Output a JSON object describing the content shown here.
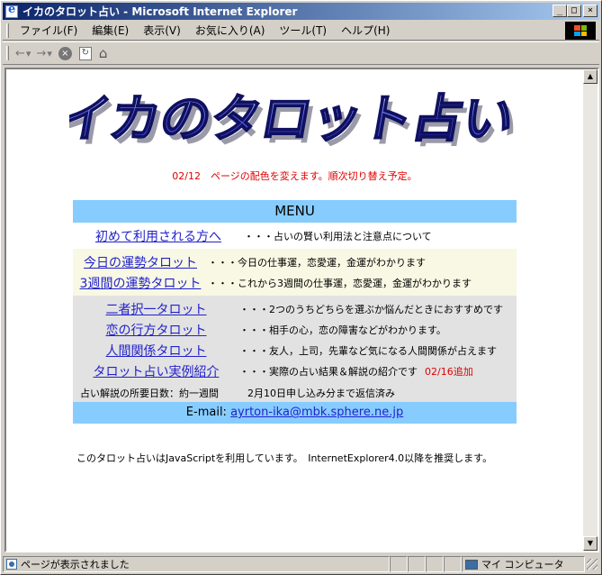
{
  "window": {
    "title": "イカのタロット占い - Microsoft Internet Explorer",
    "controls": {
      "minimize": "_",
      "maximize": "□",
      "close": "×"
    }
  },
  "menubar": [
    "ファイル(F)",
    "編集(E)",
    "表示(V)",
    "お気に入り(A)",
    "ツール(T)",
    "ヘルプ(H)"
  ],
  "toolbar": {
    "back": "←",
    "forward": "→"
  },
  "page": {
    "logo_text": "イカのタロット占い",
    "notice": "02/12　ページの配色を変えます。順次切り替え予定。",
    "menu_heading": "MENU",
    "sections": [
      {
        "style": "white",
        "items": [
          {
            "link": "初めて利用される方へ",
            "desc": "・・・占いの賢い利用法と注意点について",
            "link_w": 190
          }
        ]
      },
      {
        "style": "cream",
        "items": [
          {
            "link": "今日の運勢タロット",
            "desc": "・・・今日の仕事運，恋愛運，金運がわかります",
            "link_w": 150
          },
          {
            "link": "3週間の運勢タロット",
            "desc": "・・・これから3週間の仕事運，恋愛運，金運がわかります",
            "link_w": 150
          }
        ]
      },
      {
        "style": "gray",
        "items": [
          {
            "link": "二者択一タロット",
            "desc": "・・・2つのうちどちらを選ぶか悩んだときにおすすめです",
            "link_w": 185
          },
          {
            "link": "恋の行方タロット",
            "desc": "・・・相手の心，恋の障害などがわかります。",
            "link_w": 185
          },
          {
            "link": "人間関係タロット",
            "desc": "・・・友人，上司，先輩など気になる人間関係が占えます",
            "link_w": 185
          },
          {
            "link": "タロット占い実例紹介",
            "desc": "・・・実際の占い結果＆解説の紹介です",
            "add": "02/16追加",
            "link_w": 185
          }
        ]
      }
    ],
    "turnaround": {
      "label": "占い解説の所要日数：約一週間",
      "status": "2月10日申し込み分まで返信済み"
    },
    "email": {
      "label": "E-mail:",
      "address": "ayrton-ika@mbk.sphere.ne.jp"
    },
    "js_note": "このタロット占いはJavaScriptを利用しています。　InternetExplorer4.0以降を推奨します。"
  },
  "statusbar": {
    "message": "ページが表示されました",
    "zone": "マイ コンピュータ"
  },
  "colors": {
    "menu_header_bg": "#87ccff",
    "link": "#2222cc",
    "accent_red": "#e00000"
  }
}
